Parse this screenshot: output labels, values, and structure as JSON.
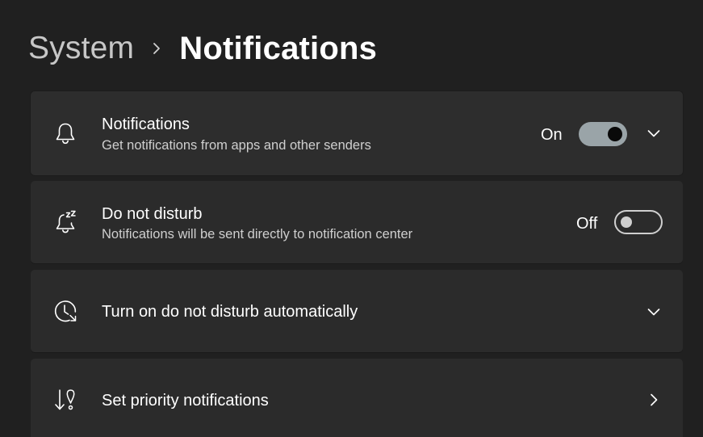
{
  "breadcrumb": {
    "parent": "System",
    "current": "Notifications"
  },
  "cards": {
    "notifications": {
      "title": "Notifications",
      "subtitle": "Get notifications from apps and other senders",
      "state_label": "On",
      "toggle_on": true,
      "icon": "bell-icon"
    },
    "dnd": {
      "title": "Do not disturb",
      "subtitle": "Notifications will be sent directly to notification center",
      "state_label": "Off",
      "toggle_on": false,
      "icon": "bell-snooze-icon"
    },
    "dnd_auto": {
      "title": "Turn on do not disturb automatically",
      "icon": "clock-history-icon"
    },
    "priority": {
      "title": "Set priority notifications",
      "icon": "priority-arrow-icon"
    }
  },
  "colors": {
    "background": "#202020",
    "card": "#2b2b2b",
    "toggle_on_track": "#9aa4a8",
    "toggle_off_border": "#cfcfcf"
  }
}
